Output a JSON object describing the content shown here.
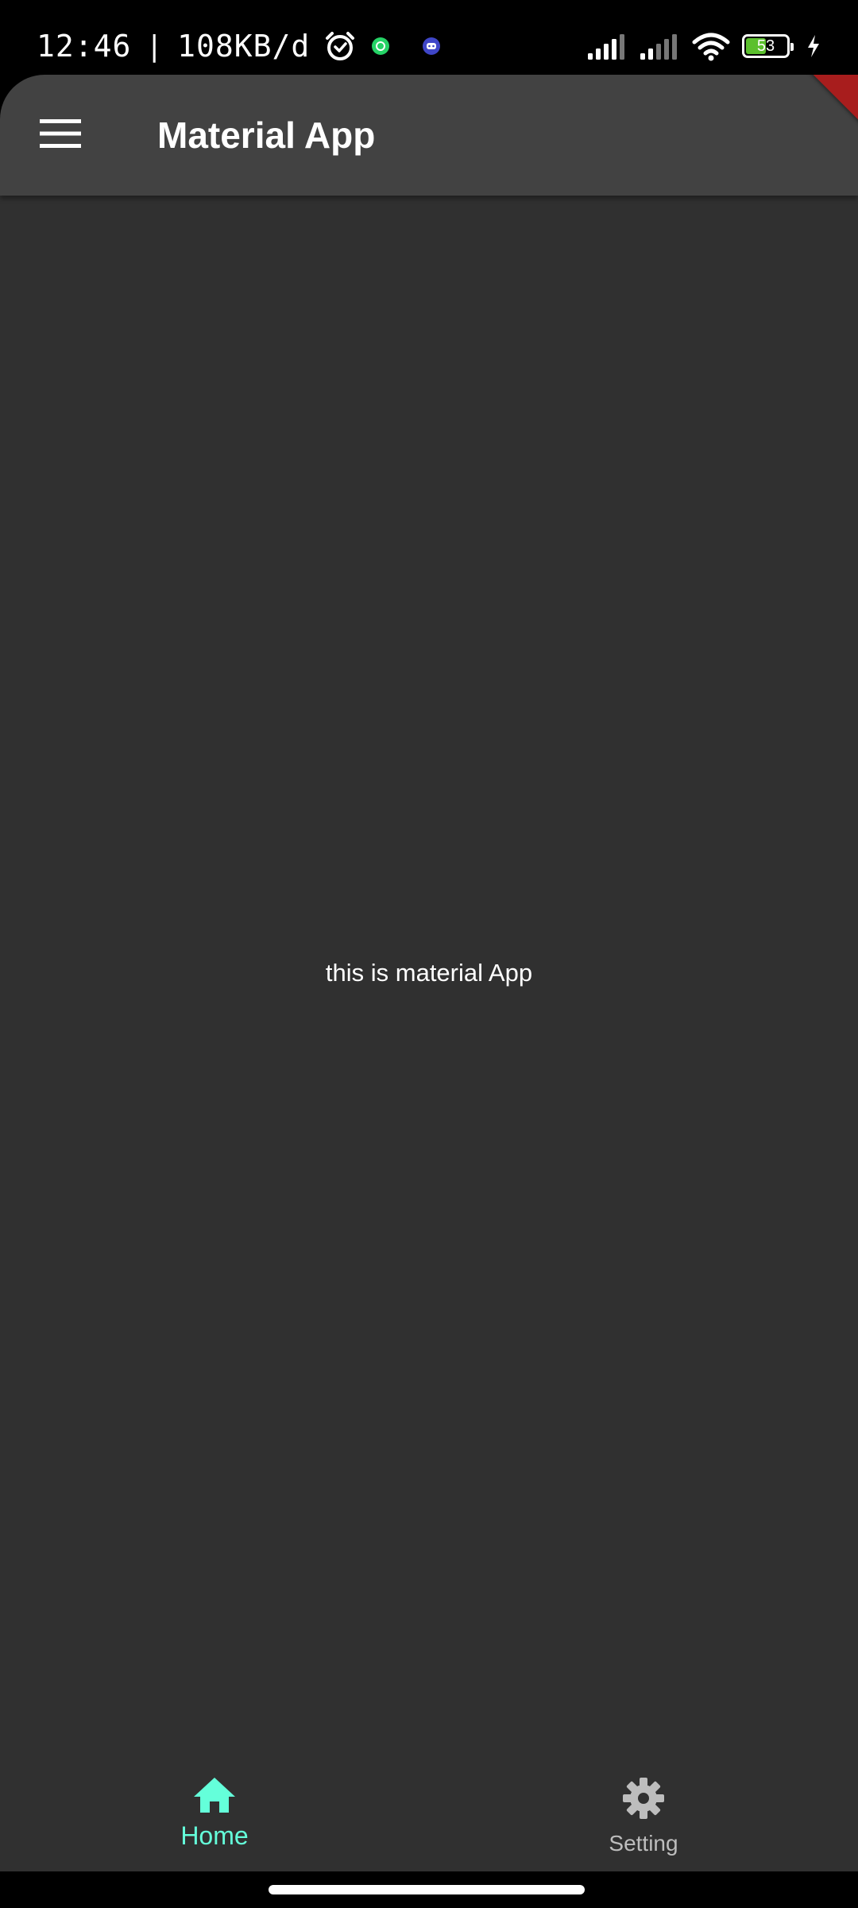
{
  "status_bar": {
    "time": "12:46",
    "separator": "|",
    "network_speed": "108KB/d",
    "battery_level": "53",
    "battery_percent": 53,
    "battery_color": "#5cc02e",
    "icons": [
      "alarm-icon",
      "whatsapp-icon",
      "discord-icon",
      "signal-icon",
      "signal-icon",
      "wifi-icon",
      "battery-icon",
      "charging-icon"
    ]
  },
  "app_bar": {
    "title": "Material App",
    "menu_icon": "menu-icon",
    "background": "#424242"
  },
  "body": {
    "text": "this is material App",
    "background": "#303030"
  },
  "bottom_nav": {
    "items": [
      {
        "label": "Home",
        "icon": "home-icon",
        "active": true
      },
      {
        "label": "Setting",
        "icon": "settings-icon",
        "active": false
      }
    ],
    "active_color": "#64ffda",
    "inactive_color": "#bdbdbd"
  }
}
